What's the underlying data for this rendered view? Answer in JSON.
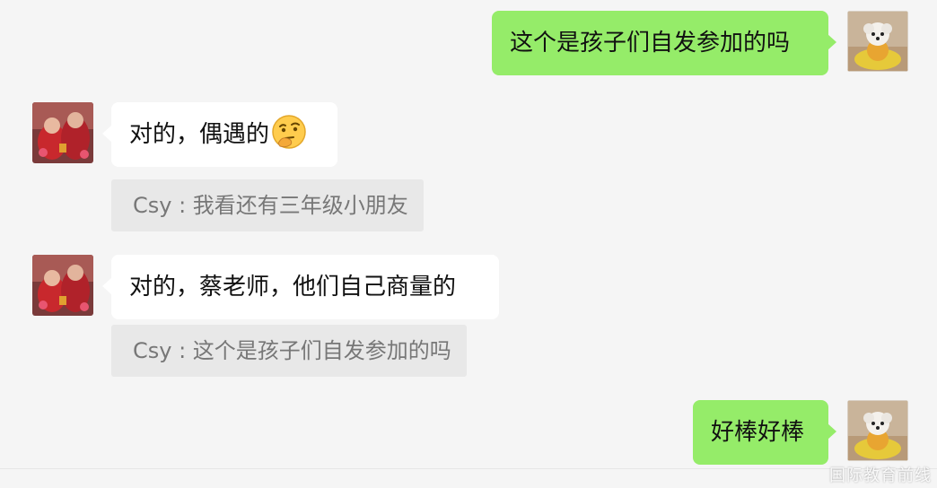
{
  "messages": [
    {
      "sender": "me",
      "text": "这个是孩子们自发参加的吗"
    },
    {
      "sender": "them",
      "text": "对的，偶遇的",
      "emoji": "thinking-emoji",
      "quote": "Csy : 我看还有三年级小朋友"
    },
    {
      "sender": "them",
      "text": "对的，蔡老师，他们自己商量的",
      "quote": "Csy : 这个是孩子们自发参加的吗"
    },
    {
      "sender": "me",
      "text": "好棒好棒"
    }
  ],
  "watermark": "国际教育前线",
  "colors": {
    "background": "#f5f5f5",
    "bubble_me": "#95ec69",
    "bubble_them": "#ffffff",
    "quote_background": "#e8e8e8",
    "quote_text": "#777777"
  },
  "avatars": {
    "me": "dog-photo-avatar",
    "them": "red-figure-photo-avatar"
  }
}
